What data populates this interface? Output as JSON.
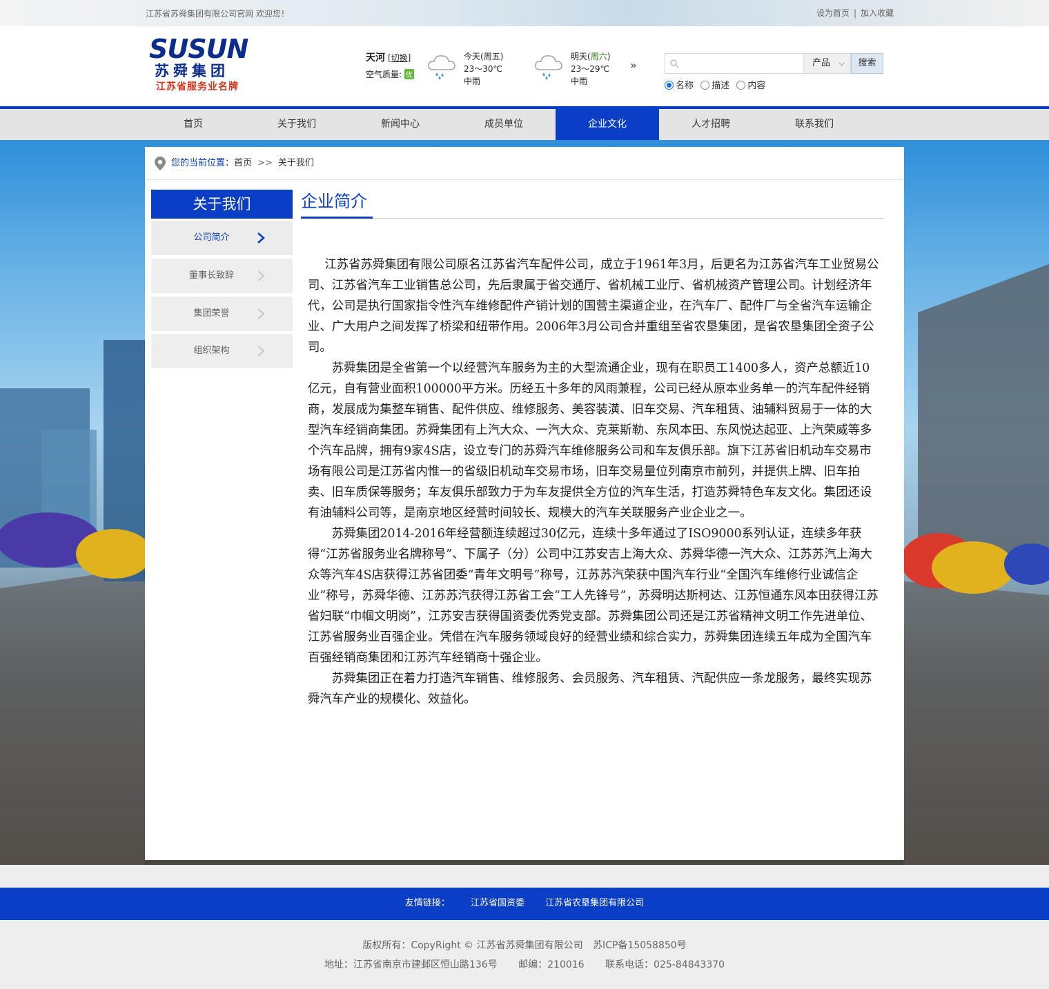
{
  "topbar": {
    "welcome": "江苏省苏舜集团有限公司官网 欢迎您！",
    "set_home": "设为首页",
    "separator": "|",
    "add_fav": "加入收藏"
  },
  "logo": {
    "en": "SUSUN",
    "cn": "苏舜集团",
    "slogan": "江苏省服务业名牌"
  },
  "weather": {
    "city": "天河",
    "switch_label": "[切换]",
    "air_label": "空气质量:",
    "air_value": "优",
    "today": {
      "label": "今天",
      "weekday": "(周五)",
      "temp": "23～30℃",
      "desc": "中雨"
    },
    "tomorrow": {
      "label": "明天",
      "weekday_open": "(",
      "weekday": "周六",
      "weekday_close": ")",
      "temp": "23～29℃",
      "desc": "中雨"
    },
    "more": "»"
  },
  "search": {
    "placeholder": "",
    "category": "产品",
    "button": "搜索",
    "options": [
      "名称",
      "描述",
      "内容"
    ],
    "selected": "名称"
  },
  "nav": {
    "items": [
      "首页",
      "关于我们",
      "新闻中心",
      "成员单位",
      "企业文化",
      "人才招聘",
      "联系我们"
    ],
    "active": "企业文化"
  },
  "breadcrumb": {
    "label": "您的当前位置",
    "colon": "：",
    "home": "首页",
    "sep": ">>",
    "current": "关于我们"
  },
  "sidebar": {
    "title": "关于我们",
    "items": [
      "公司简介",
      "董事长致辞",
      "集团荣誉",
      "组织架构"
    ],
    "active": "公司简介"
  },
  "main": {
    "title": "企业简介",
    "paragraphs": [
      "江苏省苏舜集团有限公司原名江苏省汽车配件公司，成立于1961年3月，后更名为江苏省汽车工业贸易公司、江苏省汽车工业销售总公司，先后隶属于省交通厅、省机械工业厅、省机械资产管理公司。计划经济年代，公司是执行国家指令性汽车维修配件产销计划的国营主渠道企业，在汽车厂、配件厂与全省汽车运输企业、广大用户之间发挥了桥梁和纽带作用。2006年3月公司合并重组至省农垦集团，是省农垦集团全资子公司。",
      "苏舜集团是全省第一个以经营汽车服务为主的大型流通企业，现有在职员工1400多人，资产总额近10亿元，自有营业面积100000平方米。历经五十多年的风雨兼程，公司已经从原本业务单一的汽车配件经销商，发展成为集整车销售、配件供应、维修服务、美容装潢、旧车交易、汽车租赁、油辅料贸易于一体的大型汽车经销商集团。苏舜集团有上汽大众、一汽大众、克莱斯勒、东风本田、东风悦达起亚、上汽荣威等多个汽车品牌，拥有9家4S店，设立专门的苏舜汽车维修服务公司和车友俱乐部。旗下江苏省旧机动车交易市场有限公司是江苏省内惟一的省级旧机动车交易市场，旧车交易量位列南京市前列，并提供上牌、旧车拍卖、旧车质保等服务；车友俱乐部致力于为车友提供全方位的汽车生活，打造苏舜特色车友文化。集团还设有油辅料公司等，是南京地区经营时间较长、规模大的汽车关联服务产业企业之一。",
      "苏舜集团2014-2016年经营额连续超过30亿元，连续十多年通过了ISO9000系列认证，连续多年获得“江苏省服务业名牌称号”、下属子（分）公司中江苏安吉上海大众、苏舜华德一汽大众、江苏苏汽上海大众等汽车4S店获得江苏省团委“青年文明号”称号，江苏苏汽荣获中国汽车行业“全国汽车维修行业诚信企业”称号，苏舜华德、江苏苏汽获得江苏省工会“工人先锋号”，苏舜明达斯柯达、江苏恒通东风本田获得江苏省妇联“巾帼文明岗”，江苏安吉获得国资委优秀党支部。苏舜集团公司还是江苏省精神文明工作先进单位、江苏省服务业百强企业。凭借在汽车服务领域良好的经营业绩和综合实力，苏舜集团连续五年成为全国汽车百强经销商集团和江苏汽车经销商十强企业。",
      "苏舜集团正在着力打造汽车销售、维修服务、会员服务、汽车租赁、汽配供应一条龙服务，最终实现苏舜汽车产业的规模化、效益化。"
    ]
  },
  "friend_links": {
    "label": "友情链接：",
    "items": [
      "江苏省国资委",
      "江苏省农垦集团有限公司"
    ]
  },
  "footer": {
    "copyright": "版权所有：CopyRight © 江苏省苏舜集团有限公司",
    "icp": "苏ICP备15058850号",
    "address": "地址：江苏省南京市建邺区恒山路136号",
    "postcode": "邮编：210016",
    "phone": "联系电话：025-84843370"
  },
  "colors": {
    "brand_blue": "#0a3ec5",
    "logo_blue": "#0c2c8e",
    "slogan_red": "#d6321a",
    "air_good": "#5fb836"
  }
}
